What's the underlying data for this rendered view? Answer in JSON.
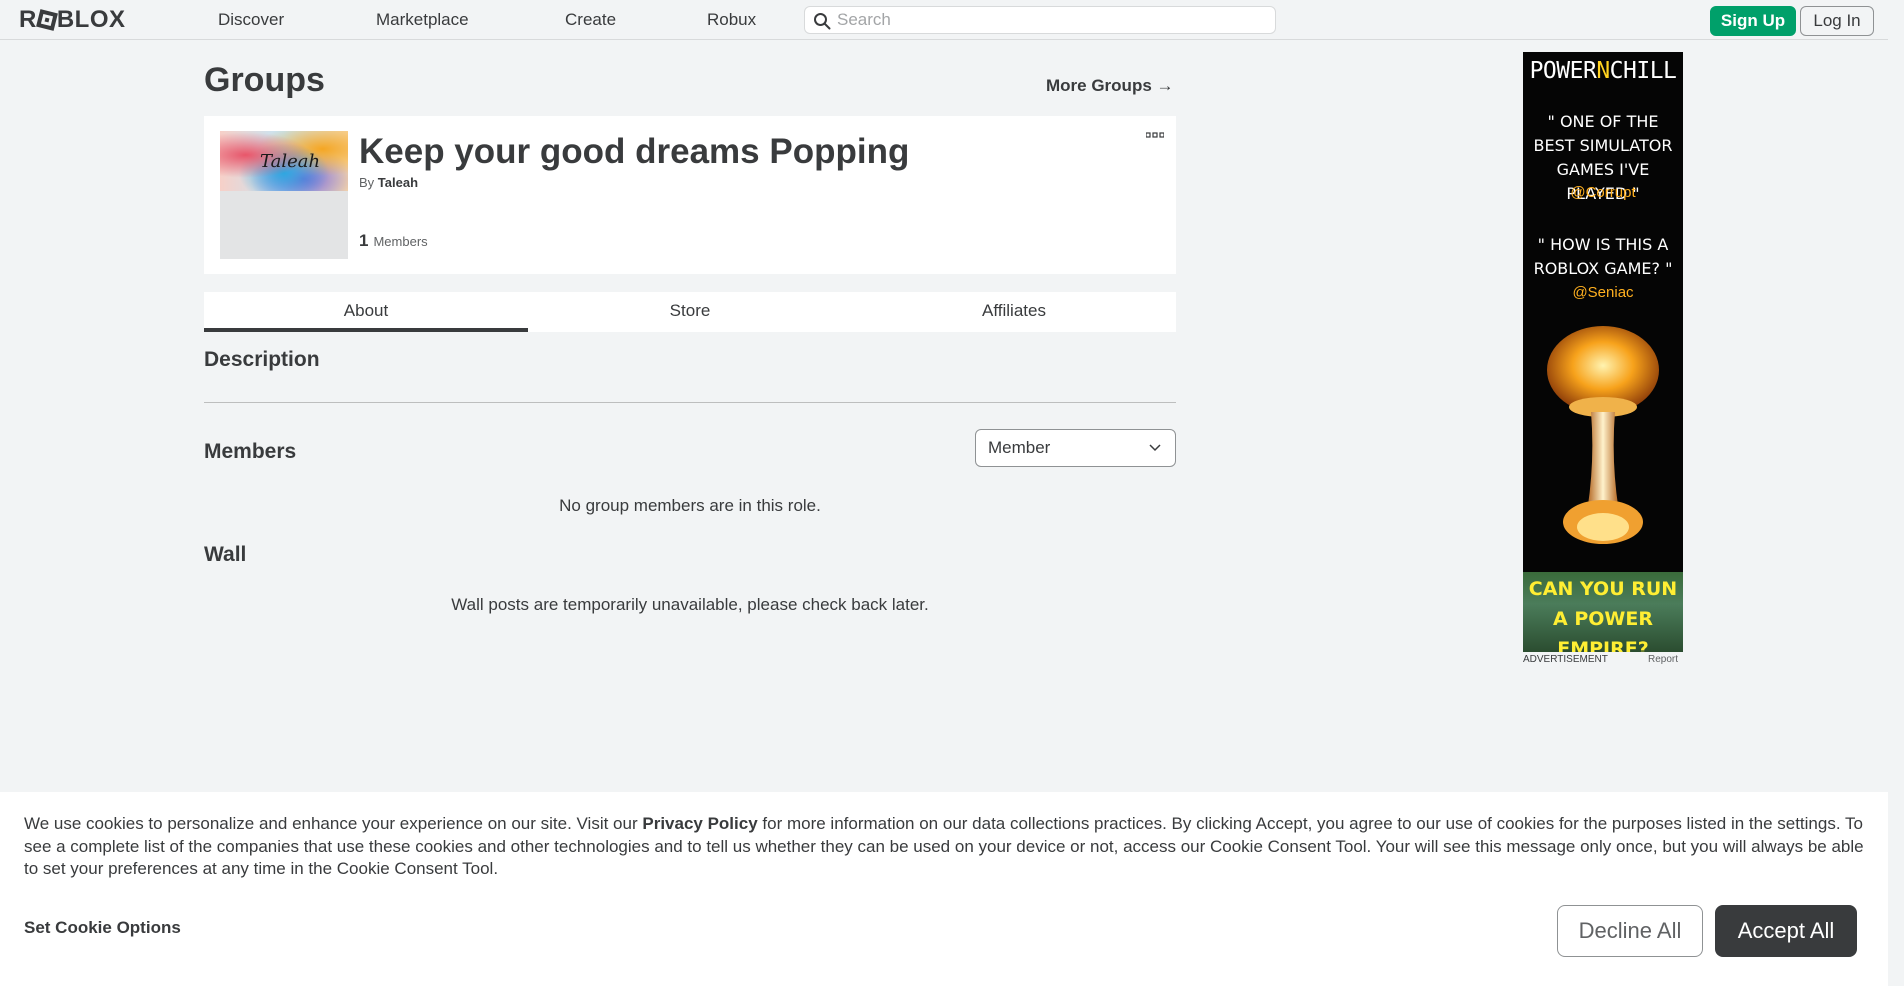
{
  "header": {
    "logo_text": "ROBLOX",
    "nav": [
      "Discover",
      "Marketplace",
      "Create",
      "Robux"
    ],
    "search_placeholder": "Search",
    "signup_label": "Sign Up",
    "login_label": "Log In"
  },
  "main": {
    "page_title": "Groups",
    "more_groups": "More Groups →",
    "group": {
      "thumb_text": "Taleah",
      "name": "Keep your good dreams Popping",
      "by_prefix": "By",
      "owner": "Taleah",
      "member_count": "1",
      "member_label": "Members"
    },
    "tabs": [
      "About",
      "Store",
      "Affiliates"
    ],
    "description_heading": "Description",
    "members_heading": "Members",
    "role_select": "Member",
    "no_members": "No group members are in this role.",
    "wall_heading": "Wall",
    "wall_message": "Wall posts are temporarily unavailable, please check back later."
  },
  "ad": {
    "brand_a": "POWER",
    "brand_b": "N",
    "brand_c": "CHILL",
    "quote1": "\" ONE OF THE BEST SIMULATOR GAMES I'VE PLAYED \"",
    "handle1": "@Corrupt",
    "quote2": "\" HOW IS THIS A ROBLOX GAME? \"",
    "handle2": "@Seniac",
    "cta": "CAN YOU RUN A POWER EMPIRE?",
    "label": "ADVERTISEMENT",
    "report": "Report"
  },
  "cookie": {
    "text_before": "We use cookies to personalize and enhance your experience on our site. Visit our ",
    "privacy_link": "Privacy Policy",
    "text_after": " for more information on our data collections practices. By clicking Accept, you agree to our use of cookies for the purposes listed in the settings. To see a complete list of the companies that use these cookies and other technologies and to tell us whether they can be used on your device or not, access our Cookie Consent Tool. Your will see this message only once, but you will always be able to set your preferences at any time in the Cookie Consent Tool.",
    "set_options": "Set Cookie Options",
    "decline": "Decline All",
    "accept": "Accept All"
  },
  "colors": {
    "background": "#f2f4f5",
    "text": "#393b3d",
    "signup_green": "#00a06a",
    "accept_dark": "#393b3d"
  }
}
